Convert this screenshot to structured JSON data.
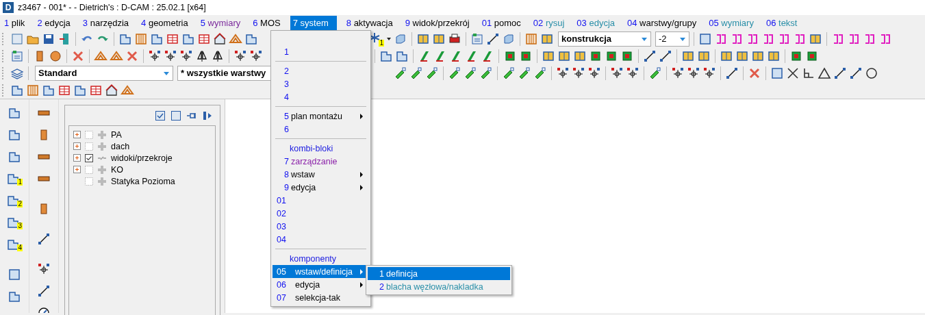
{
  "window": {
    "logo": "D",
    "title": "z3467 - 001* -  - Dietrich's : D-CAM : 25.02.1 [x64]"
  },
  "menu_bar": [
    {
      "number": "1",
      "label": "plik",
      "color": "#000000",
      "selected": false
    },
    {
      "number": "2",
      "label": "edycja",
      "color": "#000000",
      "selected": false
    },
    {
      "number": "3",
      "label": "narzędzia",
      "color": "#000000",
      "selected": false
    },
    {
      "number": "4",
      "label": "geometria",
      "color": "#000000",
      "selected": false
    },
    {
      "number": "5",
      "label": "wymiary",
      "color": "#7b2a9c",
      "selected": false
    },
    {
      "number": "6",
      "label": "MOS",
      "color": "#000000",
      "selected": false
    },
    {
      "number": "7",
      "label": "system",
      "selected": true
    },
    {
      "number": "8",
      "label": "aktywacja",
      "color": "#000000",
      "selected": false
    },
    {
      "number": "9",
      "label": "widok/przekrój",
      "color": "#000000",
      "selected": false
    },
    {
      "number": "01",
      "label": "pomoc",
      "color": "#000000",
      "selected": false
    },
    {
      "number": "02",
      "label": "rysuj",
      "color": "#2a8fa8",
      "selected": false
    },
    {
      "number": "03",
      "label": "edycja",
      "color": "#2a8fa8",
      "selected": false
    },
    {
      "number": "04",
      "label": "warstwy/grupy",
      "color": "#000000",
      "selected": false
    },
    {
      "number": "05",
      "label": "wymiary",
      "color": "#2a8fa8",
      "selected": false
    },
    {
      "number": "06",
      "label": "tekst",
      "color": "#2a8fa8",
      "selected": false
    }
  ],
  "toolbar": {
    "badge": "1",
    "construction_select": {
      "value": "konstrukcja"
    },
    "level_select": {
      "value": "-2"
    },
    "style_select": {
      "value": "Standard"
    },
    "layer_select": {
      "value": "* wszystkie warstwy"
    }
  },
  "left_toolbar": {
    "badges": [
      "1",
      "2",
      "3",
      "4"
    ]
  },
  "layer_panel": {
    "tree": [
      {
        "label": "PA",
        "kind": "group",
        "expandable": true,
        "checked": false
      },
      {
        "label": "dach",
        "kind": "group",
        "expandable": true,
        "checked": false
      },
      {
        "label": "widoki/przekroje",
        "kind": "view",
        "expandable": true,
        "checked": true
      },
      {
        "label": "KO",
        "kind": "group",
        "expandable": true,
        "checked": false
      },
      {
        "label": "Statyka Pozioma",
        "kind": "group",
        "expandable": false,
        "checked": false
      }
    ]
  },
  "system_menu": {
    "items": [
      {
        "kind": "item",
        "number": "1",
        "submenu": false,
        "selected": false
      },
      {
        "kind": "separator"
      },
      {
        "kind": "item",
        "number": "2",
        "submenu": false,
        "selected": false
      },
      {
        "kind": "item",
        "number": "3",
        "submenu": false,
        "selected": false
      },
      {
        "kind": "item",
        "number": "4",
        "submenu": false,
        "selected": false
      },
      {
        "kind": "separator"
      },
      {
        "kind": "item",
        "number": "5",
        "label": "plan montażu",
        "color": "#000000",
        "submenu": true,
        "selected": false
      },
      {
        "kind": "item",
        "number": "6",
        "submenu": false,
        "selected": false
      },
      {
        "kind": "separator"
      },
      {
        "kind": "header",
        "label": "kombi-bloki",
        "color": "#1a1ae0"
      },
      {
        "kind": "item",
        "number": "7",
        "label": "zarządzanie",
        "color": "#8a1fa8",
        "submenu": false,
        "selected": false
      },
      {
        "kind": "item",
        "number": "8",
        "label": "wstaw",
        "color": "#000000",
        "submenu": true,
        "selected": false
      },
      {
        "kind": "item",
        "number": "9",
        "label": "edycja",
        "color": "#000000",
        "submenu": true,
        "selected": false
      },
      {
        "kind": "item",
        "number": "01",
        "submenu": false,
        "selected": false
      },
      {
        "kind": "item",
        "number": "02",
        "submenu": false,
        "selected": false
      },
      {
        "kind": "item",
        "number": "03",
        "submenu": false,
        "selected": false
      },
      {
        "kind": "item",
        "number": "04",
        "submenu": false,
        "selected": false
      },
      {
        "kind": "separator"
      },
      {
        "kind": "header",
        "label": "komponenty",
        "color": "#1a1ae0"
      },
      {
        "kind": "item",
        "number": "05",
        "label": "wstaw/definicja",
        "submenu": true,
        "selected": true
      },
      {
        "kind": "item",
        "number": "06",
        "label": "edycja",
        "color": "#000000",
        "submenu": true,
        "selected": false
      },
      {
        "kind": "item",
        "number": "07",
        "label": "selekcja-tak",
        "color": "#000000",
        "submenu": false,
        "selected": false
      }
    ]
  },
  "submenu": {
    "items": [
      {
        "number": "1",
        "label": "definicja",
        "selected": true
      },
      {
        "number": "2",
        "label": "blacha węzłowa/nakladka",
        "color": "#2a8fa8",
        "selected": false
      }
    ]
  }
}
